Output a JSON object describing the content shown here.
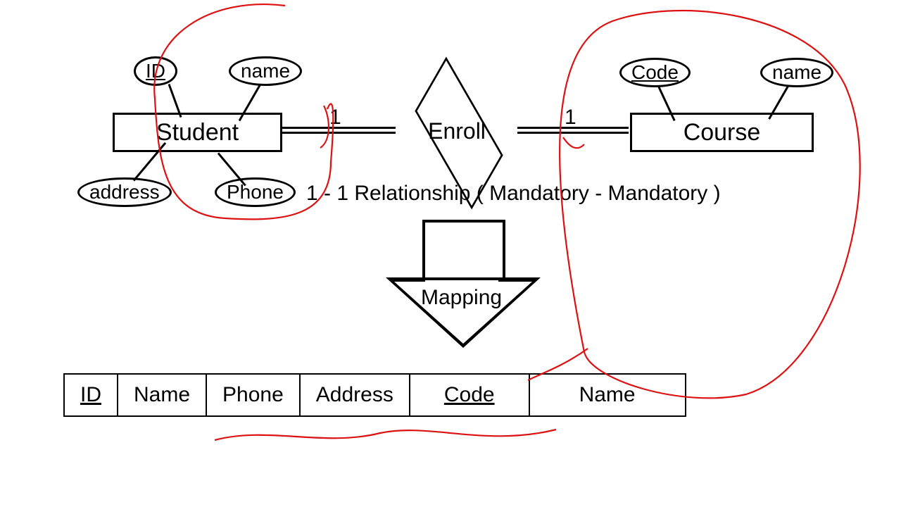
{
  "entities": {
    "student": "Student",
    "course": "Course"
  },
  "attributes": {
    "student": {
      "id": "ID",
      "name": "name",
      "address": "address",
      "phone": "Phone"
    },
    "course": {
      "code": "Code",
      "name": "name"
    }
  },
  "relationship": "Enroll",
  "cardinality": {
    "left": "1",
    "right": "1"
  },
  "caption": "1 - 1 Relationship ( Mandatory - Mandatory )",
  "arrow_label": "Mapping",
  "table": {
    "cols": [
      "ID",
      "Name",
      "Phone",
      "Address",
      "Code",
      "Name"
    ],
    "keys": [
      true,
      false,
      false,
      false,
      true,
      false
    ]
  }
}
